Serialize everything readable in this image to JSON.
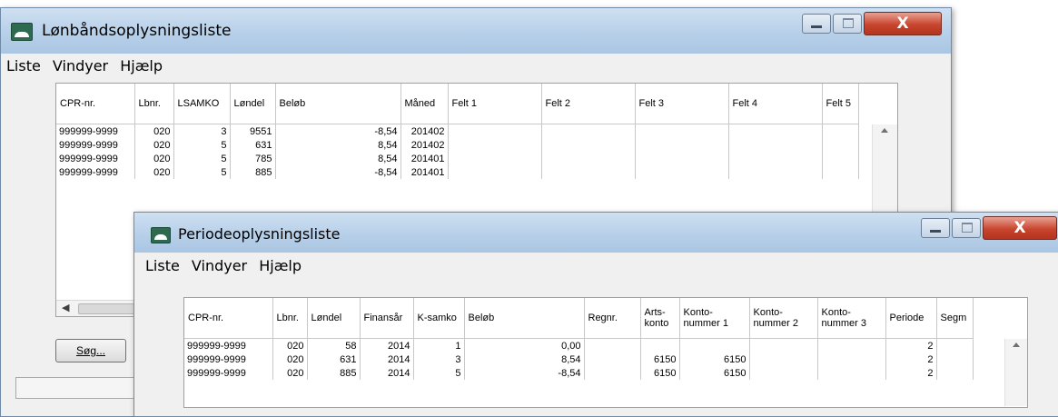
{
  "window1": {
    "title": "Lønbåndsoplysningsliste",
    "menu": [
      "Liste",
      "Vindyer",
      "Hjælp"
    ],
    "close_glyph": "X",
    "columns": [
      "CPR-nr.",
      "Lbnr.",
      "LSAMKO",
      "Løndel",
      "Beløb",
      "Måned",
      "Felt 1",
      "Felt 2",
      "Felt 3",
      "Felt 4",
      "Felt 5"
    ],
    "rows": [
      [
        "999999-9999",
        "020",
        "3",
        "9551",
        "-8,54",
        "201402",
        "",
        "",
        "",
        "",
        ""
      ],
      [
        "999999-9999",
        "020",
        "5",
        "631",
        "8,54",
        "201402",
        "",
        "",
        "",
        "",
        ""
      ],
      [
        "999999-9999",
        "020",
        "5",
        "785",
        "8,54",
        "201401",
        "",
        "",
        "",
        "",
        ""
      ],
      [
        "999999-9999",
        "020",
        "5",
        "885",
        "-8,54",
        "201401",
        "",
        "",
        "",
        "",
        ""
      ]
    ],
    "search_button": "Søg..."
  },
  "window2": {
    "title": "Periodeoplysningsliste",
    "menu": [
      "Liste",
      "Vindyer",
      "Hjælp"
    ],
    "close_glyph": "X",
    "columns": [
      "CPR-nr.",
      "Lbnr.",
      "Løndel",
      "Finansår",
      "K-samko",
      "Beløb",
      "Regnr.",
      "Arts-\nkonto",
      "Konto-\nnummer 1",
      "Konto-\nnummer 2",
      "Konto-\nnummer 3",
      "Periode",
      "Segm"
    ],
    "rows": [
      [
        "999999-9999",
        "020",
        "58",
        "2014",
        "1",
        "0,00",
        "",
        "",
        "",
        "",
        "",
        "2",
        ""
      ],
      [
        "999999-9999",
        "020",
        "631",
        "2014",
        "3",
        "8,54",
        "",
        "6150",
        "6150",
        "",
        "",
        "2",
        ""
      ],
      [
        "999999-9999",
        "020",
        "885",
        "2014",
        "5",
        "-8,54",
        "",
        "6150",
        "6150",
        "",
        "",
        "2",
        ""
      ]
    ]
  }
}
